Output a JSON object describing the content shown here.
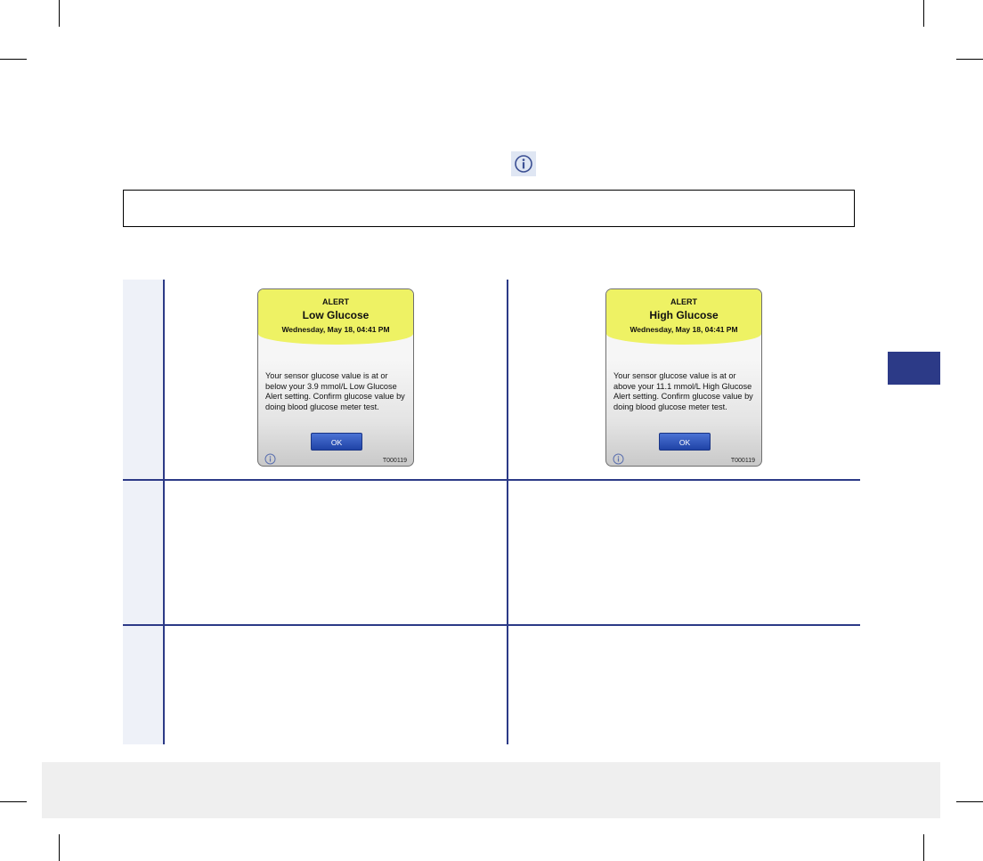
{
  "header": {
    "info_icon": "info-circle-icon"
  },
  "alerts": {
    "low": {
      "kicker": "ALERT",
      "title": "Low Glucose",
      "date": "Wednesday, May 18, 04:41 PM",
      "message": "Your sensor glucose value is at or below your 3.9 mmol/L Low Glucose Alert setting. Confirm glucose value by doing blood glucose meter test.",
      "button": "OK",
      "code": "T000119",
      "info_icon": "info-circle-icon"
    },
    "high": {
      "kicker": "ALERT",
      "title": "High Glucose",
      "date": "Wednesday, May 18, 04:41 PM",
      "message": "Your sensor glucose value is at or above your 11.1 mmol/L High Glucose Alert setting. Confirm glucose value by doing blood glucose meter test.",
      "button": "OK",
      "code": "T000119",
      "info_icon": "info-circle-icon"
    }
  },
  "colors": {
    "accent": "#2c3a87",
    "alert_header": "#eef264",
    "button": "#2f55bd",
    "footer_band": "#efefef",
    "row_header_fill": "#eef1f8"
  }
}
